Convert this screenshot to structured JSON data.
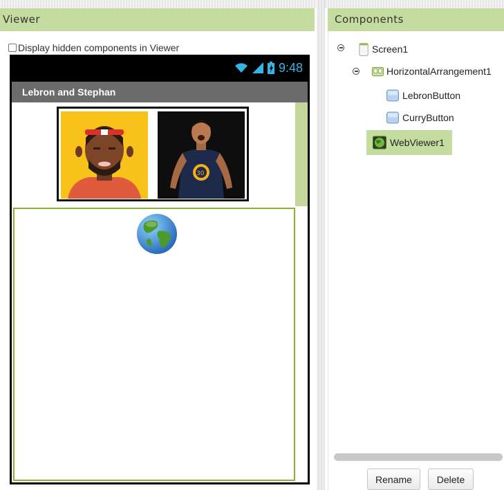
{
  "viewer": {
    "title": "Viewer",
    "hidden_checkbox_label": "Display hidden components in Viewer",
    "hidden_checked": false,
    "status_time": "9:48",
    "app_title": "Lebron and Stephan"
  },
  "components": {
    "title": "Components",
    "tree": [
      {
        "label": "Screen1",
        "icon": "screen-icon",
        "expanded": true
      },
      {
        "label": "HorizontalArrangement1",
        "icon": "horizontal-arrangement-icon",
        "expanded": true
      },
      {
        "label": "LebronButton",
        "icon": "button-icon"
      },
      {
        "label": "CurryButton",
        "icon": "button-icon"
      },
      {
        "label": "WebViewer1",
        "icon": "webviewer-icon",
        "selected": true
      }
    ],
    "rename_label": "Rename",
    "delete_label": "Delete"
  },
  "colors": {
    "header_bg": "#c5dca0",
    "selected_bg": "#c5dca0",
    "status_time": "#33b5e5",
    "title_bar": "#6b6b6b",
    "webviewer_border": "#86b23a"
  }
}
